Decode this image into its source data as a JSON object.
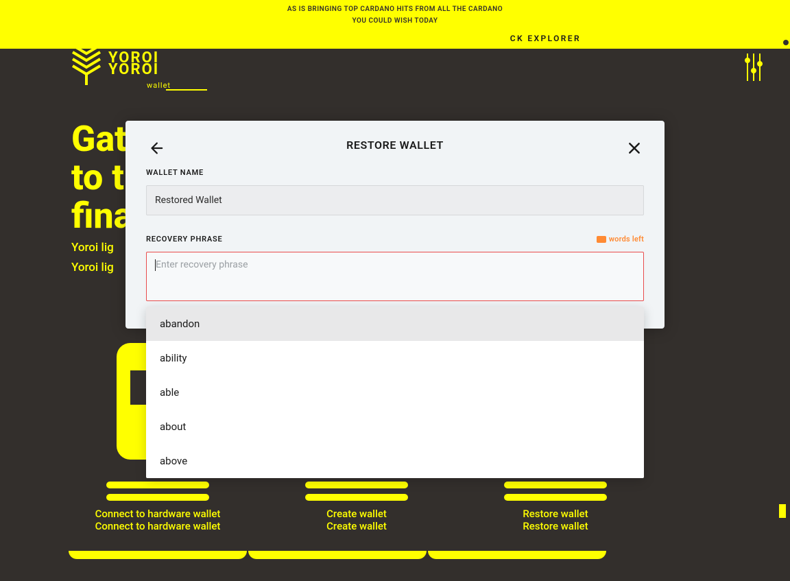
{
  "banner": {
    "line1": "AS IS BRINGING TOP CARDANO HITS FROM ALL THE CARDANO",
    "line2": "YOU COULD WISH TODAY",
    "explorer": "CK EXPLORER"
  },
  "brand": {
    "name": "YOROI",
    "name2": "YOROI",
    "sub": "wallet"
  },
  "hero": {
    "line1": "Gat",
    "line2": "to t",
    "line3": "fina",
    "sub1": "Yoroi lig",
    "sub2": "Yoroi lig"
  },
  "cards": {
    "connect": {
      "label": "Connect to hardware wallet",
      "label2": "Connect to hardware wallet"
    },
    "create": {
      "label": "Create wallet",
      "label2": "Create wallet"
    },
    "restore": {
      "label": "Restore wallet",
      "label2": "Restore wallet"
    }
  },
  "modal": {
    "title": "RESTORE WALLET",
    "wallet_name_label": "WALLET NAME",
    "wallet_name_value": "Restored Wallet",
    "recovery_label": "RECOVERY PHRASE",
    "recovery_placeholder": "Enter recovery phrase",
    "words_left_label": "words left"
  },
  "suggestions": [
    "abandon",
    "ability",
    "able",
    "about",
    "above"
  ]
}
